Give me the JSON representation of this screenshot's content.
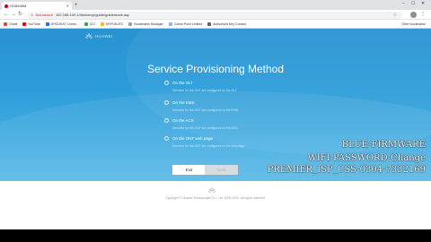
{
  "browser": {
    "tab_title": "HG8546M",
    "new_tab": "+",
    "url_warning": "Not secure",
    "url": "192.168.100.1/html/amp/guide/guidemode.asp",
    "other_bookmarks": "Other bookmarks",
    "bookmarks": [
      {
        "label": "Gmail",
        "color": "#ea4335"
      },
      {
        "label": "YouTube",
        "color": "#ff0000"
      },
      {
        "label": "SHOUKAT Comm...",
        "color": "#1a73e8"
      },
      {
        "label": "GCI",
        "color": "#34a853"
      },
      {
        "label": "MYFUN-IEC",
        "color": "#fbbc05"
      },
      {
        "label": "Bookmarks Manager",
        "color": "#9aa0a6"
      },
      {
        "label": "Comm Point Limited",
        "color": "#8ab4f8"
      },
      {
        "label": "Authorised Key Contact",
        "color": "#5f6368"
      }
    ]
  },
  "page": {
    "brand": "HUAWEI",
    "title": "Service Provisioning Method",
    "options": [
      {
        "label": "On the OLT",
        "desc": "Services for the ONT are configured on the OLT."
      },
      {
        "label": "On the EMS",
        "desc": "Services for the ONT are configured on the EMS."
      },
      {
        "label": "On the ACS",
        "desc": "Services for the ONT are configured on the ACS."
      },
      {
        "label": "On the ONT web page",
        "desc": "Services for the ONT are configured on the web page."
      }
    ],
    "exit_label": "Exit",
    "next_label": "Next"
  },
  "overlay": {
    "line1": "BLUE-FIRMWARE",
    "line2": "WIFI-PASSWORD-Change",
    "line3": "PREMIER_ISP_CSS-0304-7332169"
  },
  "footer": {
    "copyright": "Copyright © Huawei Technologies Co., Ltd. 2009-2020. All rights reserved."
  }
}
